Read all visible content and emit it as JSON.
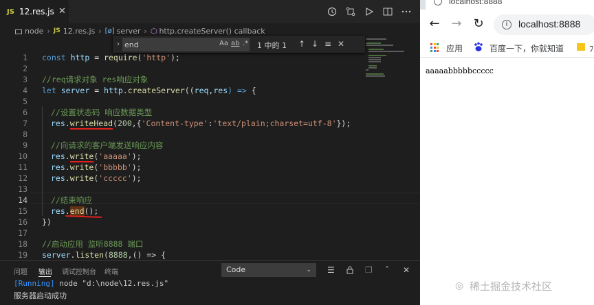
{
  "editor": {
    "tab": {
      "badge": "JS",
      "label": "12.res.js",
      "close": "✕"
    },
    "toolbar_icons": [
      "history-icon",
      "git-compare-icon",
      "run-icon",
      "split-editor-icon",
      "more-icon"
    ],
    "breadcrumb": [
      "node",
      "12.res.js",
      "server",
      "http.createServer() callback"
    ],
    "breadcrumb_badges": {
      "js": "JS",
      "var": "[ø]",
      "fn": "⬡"
    },
    "find": {
      "value": "end",
      "count": "1 中的 1",
      "opt_case": "Aa",
      "opt_word": "ab",
      "opt_regex": ".*",
      "toggle": "›",
      "prev": "↑",
      "next": "↓",
      "select": "≡",
      "close": "✕"
    },
    "line_numbers": [
      "1",
      "2",
      "3",
      "4",
      "5",
      "6",
      "7",
      "8",
      "9",
      "10",
      "11",
      "12",
      "13",
      "14",
      "15",
      "16",
      "17",
      "18",
      "19",
      "20"
    ],
    "code": {
      "l1": [
        "const",
        " ",
        "http",
        " = ",
        "require",
        "(",
        "'http'",
        ");"
      ],
      "l3": "//req请求对象 res响应对象",
      "l4": [
        "let",
        " ",
        "server",
        " = ",
        "http",
        ".",
        "createServer",
        "((",
        "req",
        ",",
        "res",
        ") => ",
        "{"
      ],
      "l6": "//设置状态码 响应数据类型",
      "l7": [
        "res",
        ".",
        "writeHead",
        "(",
        "200",
        ",{",
        "'Content-type'",
        ":",
        "'text/plain;charset=utf-8'",
        "});"
      ],
      "l9": "//向请求的客户端发送响应内容",
      "l10": [
        "res",
        ".",
        "write",
        "(",
        "'aaaaa'",
        ");"
      ],
      "l11": [
        "res",
        ".",
        "write",
        "(",
        "'bbbbb'",
        ");"
      ],
      "l12": [
        "res",
        ".",
        "write",
        "(",
        "'ccccc'",
        ");"
      ],
      "l14": "//结束响应",
      "l15": [
        "res",
        ".",
        "end",
        "();"
      ],
      "l16": "})",
      "l18": "//启动应用 监听8888 端口",
      "l19": [
        "server",
        ".",
        "listen",
        "(",
        "8888",
        ",() => {"
      ]
    }
  },
  "panel": {
    "tabs": [
      "问题",
      "输出",
      "调试控制台",
      "终端"
    ],
    "active_tab": "输出",
    "channel": "Code",
    "channel_chevron": "⌄",
    "icons": {
      "filter": "☰",
      "lock": "🔒",
      "copy": "❐",
      "maximize": "ˆ",
      "close": "✕"
    },
    "output": {
      "running": "[Running]",
      "command": " node \"d:\\node\\12.res.js\"",
      "message": "服务器启动成功"
    }
  },
  "browser": {
    "tab_title": "localhost:8888",
    "url": "localhost:8888",
    "nav": {
      "back": "←",
      "forward": "→",
      "reload": "↻",
      "info": "i"
    },
    "bookmarks": {
      "apps": "应用",
      "baidu": "百度一下，你就知道",
      "cut": "ﾌ"
    },
    "page_text": "aaaaabbbbbccccc"
  },
  "watermark": {
    "icon": "◎",
    "text": "稀土掘金技术社区"
  },
  "colors": {
    "accent_red": "#e0211d",
    "keyword": "#569cd6",
    "variable": "#9cdcfe",
    "function": "#dcdcaa",
    "string": "#ce9178",
    "number": "#b5cea8",
    "comment": "#6a9955"
  }
}
